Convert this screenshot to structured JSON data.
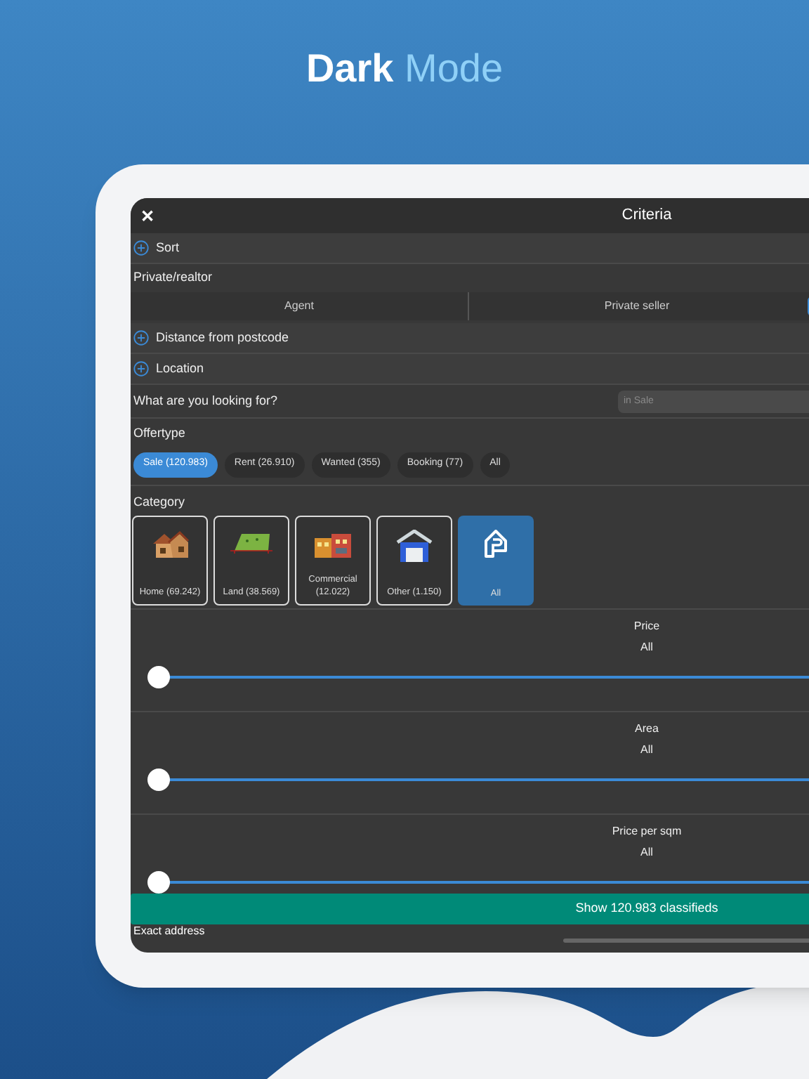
{
  "headline": {
    "strong": "Dark",
    "light": "Mode"
  },
  "window": {
    "close": "✕",
    "title": "Criteria"
  },
  "rows": [
    {
      "kind": "expander",
      "label": "Sort"
    },
    {
      "kind": "heading",
      "label": "Private/realtor"
    },
    {
      "kind": "segments",
      "segments": [
        {
          "label": "Agent",
          "selected": false
        },
        {
          "label": "Private seller",
          "selected": false
        },
        {
          "selected": true
        }
      ]
    },
    {
      "kind": "expander",
      "label": "Distance from postcode"
    },
    {
      "kind": "expander",
      "label": "Location"
    },
    {
      "kind": "search",
      "label": "What are you looking for?",
      "placeholder": "in Sale"
    }
  ],
  "offertype": {
    "title": "Offertype",
    "chips": [
      {
        "label": "Sale (120.983)",
        "selected": true
      },
      {
        "label": "Rent (26.910)",
        "selected": false
      },
      {
        "label": "Wanted (355)",
        "selected": false
      },
      {
        "label": "Booking (77)",
        "selected": false
      },
      {
        "label": "All",
        "selected": false
      }
    ]
  },
  "category": {
    "title": "Category",
    "tiles": [
      {
        "kind": "home",
        "label": "Home (69.242)",
        "selected": false
      },
      {
        "kind": "land",
        "label": "Land (38.569)",
        "selected": false
      },
      {
        "kind": "commercial",
        "label": "Commercial (12.022)",
        "selected": false
      },
      {
        "kind": "other",
        "label": "Other (1.150)",
        "selected": false
      },
      {
        "kind": "all",
        "label": "All",
        "selected": true
      }
    ]
  },
  "sliders": [
    {
      "label": "Price",
      "value": "All",
      "level": 0
    },
    {
      "label": "Area",
      "value": "All",
      "level": 0
    },
    {
      "label": "Price per sqm",
      "value": "All",
      "level": 0
    }
  ],
  "show_button": "Show 120.983 classifieds",
  "exact_address": "Exact address"
}
